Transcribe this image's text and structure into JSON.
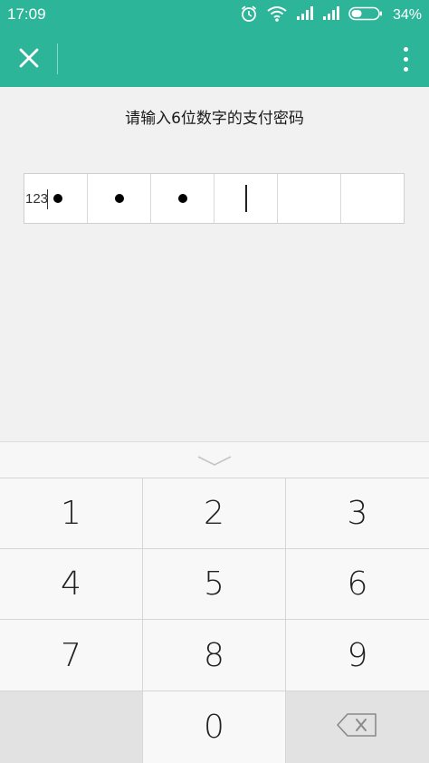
{
  "status_bar": {
    "time": "17:09",
    "battery_percent": "34%",
    "icons": [
      "alarm-icon",
      "wifi-icon",
      "signal-icon",
      "signal-icon",
      "battery-icon"
    ]
  },
  "app_bar": {
    "close_icon": "close-icon",
    "more_icon": "more-vertical-icon",
    "background": "#2db59a"
  },
  "prompt": "请输入6位数字的支付密码",
  "pin": {
    "length": 6,
    "entered": 3,
    "debug_text": "123"
  },
  "keypad": {
    "collapse_icon": "chevron-down-icon",
    "keys": [
      "1",
      "2",
      "3",
      "4",
      "5",
      "6",
      "7",
      "8",
      "9",
      "",
      "0",
      "backspace"
    ]
  }
}
